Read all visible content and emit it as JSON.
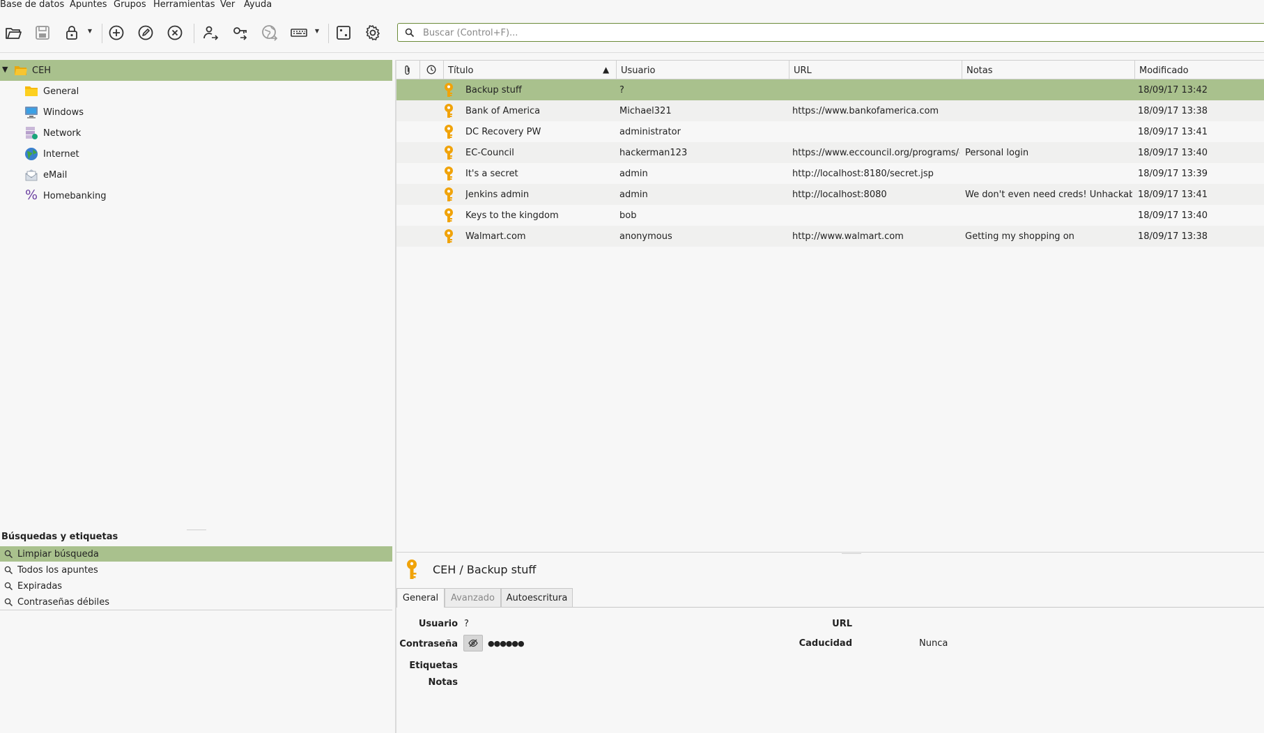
{
  "menu": [
    "Base de datos",
    "Apuntes",
    "Grupos",
    "Herramientas",
    "Ver",
    "Ayuda"
  ],
  "search": {
    "placeholder": "Buscar (Control+F)..."
  },
  "tree": {
    "root": "CEH",
    "children": [
      "General",
      "Windows",
      "Network",
      "Internet",
      "eMail",
      "Homebanking"
    ]
  },
  "searches": {
    "title": "Búsquedas y etiquetas",
    "items": [
      "Limpiar búsqueda",
      "Todos los apuntes",
      "Expiradas",
      "Contraseñas débiles"
    ]
  },
  "table": {
    "columns": [
      "Título",
      "Usuario",
      "URL",
      "Notas",
      "Modificado"
    ],
    "rows": [
      {
        "title": "Backup stuff",
        "user": "?",
        "url": "",
        "notes": "",
        "modified": "18/09/17 13:42"
      },
      {
        "title": "Bank of America",
        "user": "Michael321",
        "url": "https://www.bankofamerica.com",
        "notes": "",
        "modified": "18/09/17 13:38"
      },
      {
        "title": "DC Recovery PW",
        "user": "administrator",
        "url": "",
        "notes": "",
        "modified": "18/09/17 13:41"
      },
      {
        "title": "EC-Council",
        "user": "hackerman123",
        "url": "https://www.eccouncil.org/programs/c...",
        "notes": "Personal login",
        "modified": "18/09/17 13:40"
      },
      {
        "title": "It's a secret",
        "user": "admin",
        "url": "http://localhost:8180/secret.jsp",
        "notes": "",
        "modified": "18/09/17 13:39"
      },
      {
        "title": "Jenkins admin",
        "user": "admin",
        "url": "http://localhost:8080",
        "notes": "We don't even need creds! Unhackable!",
        "modified": "18/09/17 13:41"
      },
      {
        "title": "Keys to the kingdom",
        "user": "bob",
        "url": "",
        "notes": "",
        "modified": "18/09/17 13:40"
      },
      {
        "title": "Walmart.com",
        "user": "anonymous",
        "url": "http://www.walmart.com",
        "notes": "Getting my shopping on",
        "modified": "18/09/17 13:38"
      }
    ]
  },
  "preview": {
    "title": "CEH / Backup stuff",
    "tabs": [
      "General",
      "Avanzado",
      "Autoescritura"
    ],
    "labels": {
      "user": "Usuario",
      "password": "Contraseña",
      "tags": "Etiquetas",
      "notes": "Notas",
      "url": "URL",
      "expiry": "Caducidad"
    },
    "values": {
      "user": "?",
      "password": "●●●●●●",
      "expiry": "Nunca"
    }
  },
  "colors": {
    "selection": "#a9c18d",
    "key": "#f0a30a",
    "accent_border": "#6b8b38"
  }
}
